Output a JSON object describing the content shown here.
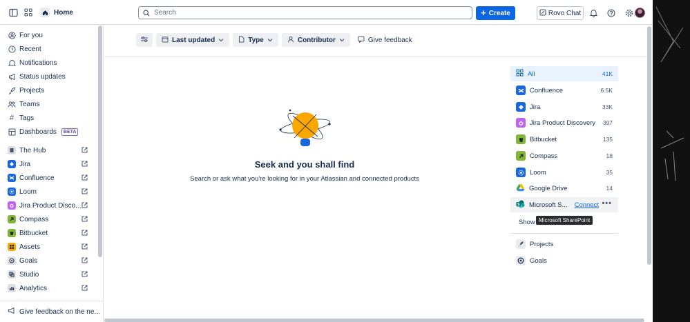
{
  "topbar": {
    "home_label": "Home",
    "search_placeholder": "Search",
    "create_label": "Create",
    "rovo_label": "Rovo Chat"
  },
  "sidebar": {
    "items": [
      {
        "label": "For you",
        "icon": "user-circle-icon"
      },
      {
        "label": "Recent",
        "icon": "clock-icon"
      },
      {
        "label": "Notifications",
        "icon": "bell-icon"
      },
      {
        "label": "Status updates",
        "icon": "megaphone-icon"
      },
      {
        "label": "Projects",
        "icon": "rocket-icon"
      },
      {
        "label": "Teams",
        "icon": "people-icon"
      },
      {
        "label": "Tags",
        "icon": "hash-icon"
      },
      {
        "label": "Dashboards",
        "icon": "dashboard-icon",
        "badge": "BETA"
      }
    ],
    "apps": [
      {
        "label": "The Hub",
        "color": "#44546f"
      },
      {
        "label": "Jira",
        "color": "#1868db"
      },
      {
        "label": "Confluence",
        "color": "#1868db"
      },
      {
        "label": "Loom",
        "color": "#1868db"
      },
      {
        "label": "Jira Product Disco...",
        "color": "#bf63f3"
      },
      {
        "label": "Compass",
        "color": "#82b536"
      },
      {
        "label": "Bitbucket",
        "color": "#82b536"
      },
      {
        "label": "Assets",
        "color": "#fca700"
      },
      {
        "label": "Goals",
        "color": "#44546f"
      },
      {
        "label": "Studio",
        "color": "#44546f"
      },
      {
        "label": "Analytics",
        "color": "#44546f"
      }
    ],
    "feedback_label": "Give feedback on the ne..."
  },
  "filters": {
    "last_updated": "Last updated",
    "type": "Type",
    "contributor": "Contributor",
    "feedback": "Give feedback"
  },
  "empty": {
    "title": "Seek and you shall find",
    "subtitle": "Search or ask what you're looking for in your Atlassian and connected products"
  },
  "sources": [
    {
      "label": "All",
      "count": "41K"
    },
    {
      "label": "Confluence",
      "count": "6.5K"
    },
    {
      "label": "Jira",
      "count": "33K"
    },
    {
      "label": "Jira Product Discovery",
      "count": "397"
    },
    {
      "label": "Bitbucket",
      "count": "135"
    },
    {
      "label": "Compass",
      "count": "18"
    },
    {
      "label": "Loom",
      "count": "35"
    },
    {
      "label": "Google Drive",
      "count": "14"
    },
    {
      "label": "Microsoft S...",
      "connect": "Connect",
      "more": "•••"
    }
  ],
  "show_label": "Show",
  "tooltip": "Microsoft SharePoint",
  "other": [
    {
      "label": "Projects"
    },
    {
      "label": "Goals"
    }
  ]
}
